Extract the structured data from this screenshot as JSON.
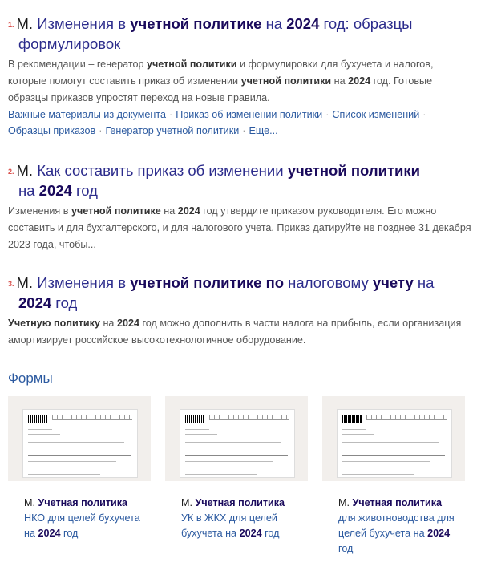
{
  "results": [
    {
      "num": "1.",
      "title_parts": [
        "М.",
        " Изменения в ",
        "учетной политике",
        " на ",
        "2024",
        " год: образцы"
      ],
      "title_line2": "формулировок",
      "snippet_parts": [
        "В рекомендации – генератор ",
        "учетной политики",
        " и формулировки для бухучета и налогов, которые помогут составить приказ об изменении ",
        "учетной политики",
        " на ",
        "2024",
        " год. Готовые образцы приказов упростят переход на новые правила."
      ],
      "links": [
        "Важные материалы из документа",
        "Приказ об изменении политики",
        "Список изменений",
        "Образцы приказов",
        "Генератор учетной политики",
        "Еще..."
      ]
    },
    {
      "num": "2.",
      "title_parts": [
        "М.",
        " Как составить приказ об изменении ",
        "учетной политики"
      ],
      "title_line2_parts": [
        "на ",
        "2024",
        " год"
      ],
      "snippet_parts": [
        "Изменения в ",
        "учетной политике",
        " на ",
        "2024",
        " год утвердите приказом руководителя. Его можно составить и для бухгалтерского, и для налогового учета. Приказ датируйте не позднее 31 декабря 2023 года, чтобы..."
      ]
    },
    {
      "num": "3.",
      "title_parts": [
        "М.",
        " Изменения в ",
        "учетной политике по",
        " налоговому ",
        "учету",
        " на"
      ],
      "title_line2_parts": [
        "2024",
        " год"
      ],
      "snippet_parts": [
        "Учетную политику",
        " на ",
        "2024",
        " год можно дополнить в части налога на прибыль, если организация амортизирует российское высокотехнологичное оборудование."
      ]
    }
  ],
  "forms": {
    "heading": "Формы",
    "cards": [
      {
        "m": "М.",
        "bold": "Учетная политика",
        "rest": "НКО для целей бухучета на ",
        "year": "2024",
        "tail": " год"
      },
      {
        "m": "М.",
        "bold": "Учетная политика",
        "rest": "УК в ЖКХ для целей бухучета на ",
        "year": "2024",
        "tail": " год"
      },
      {
        "m": "М.",
        "bold": "Учетная политика",
        "rest": "для животноводства для целей бухучета на ",
        "year": "2024",
        "tail": " год"
      }
    ]
  }
}
